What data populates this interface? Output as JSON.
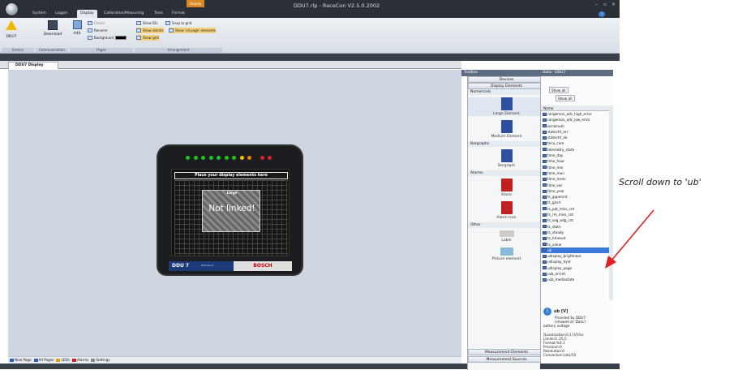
{
  "window": {
    "title": "DDU7.rlp - RaceCon V2.5.0.2002",
    "context_tab": "Display",
    "minimize": "–",
    "maximize": "▫",
    "close": "×",
    "help": "?"
  },
  "tabs": [
    "System",
    "Logger",
    "Display",
    "Calibration/Measuring",
    "Tools",
    "Format"
  ],
  "ribbon": {
    "ddu7_label": "DDU7",
    "download_label": "Download",
    "add_label": "Add",
    "create": "Create",
    "rename": "Rename",
    "background": "Background",
    "show_ids": "Show IDs",
    "snap_to_grid": "Snap to grid",
    "show_alarms": "Show alarms",
    "show_all_page_elements": "Show 'all page' elements",
    "show_grid": "Show grid",
    "groups": [
      "Device",
      "Communication",
      "Pages",
      "Arrangement"
    ]
  },
  "document": {
    "tab": "DDU7 Display",
    "screen_header": "Place your display elements here",
    "element_label": "Large",
    "element_text": "Not linked!",
    "device_name": "DDU 7",
    "brand": "BOSCH",
    "brand_sub": "Motorsport"
  },
  "leds": [
    "#1cc41c",
    "#1cc41c",
    "#1cc41c",
    "#1cc41c",
    "#1cc41c",
    "#1cc41c",
    "#1cc41c",
    "#f0c000",
    "#f08000",
    "#e02020",
    "#e02020"
  ],
  "page_tabs": [
    "New Page",
    "All Pages",
    "LEDs",
    "Alarms",
    "Settings"
  ],
  "toolbox": {
    "title": "Toolbox",
    "devices": "Devices",
    "display_elements": "Display Elements",
    "sections": {
      "numericals": "Numericals",
      "bargraphs": "Bargraphs",
      "alarms": "Alarms",
      "other": "Other"
    },
    "items": {
      "large": "Large Element",
      "medium": "Medium Element",
      "bargraph": "Bargraph",
      "alarm": "Alarm",
      "alarm_icon": "Alarm Icon",
      "label": "Label",
      "picture": "Picture element"
    },
    "measurement_elements": "Measurement Elements",
    "measurement_sources": "Measurement Sources"
  },
  "data": {
    "title": "Data - DDU7",
    "show_all": "Show all",
    "column": "Name",
    "items": [
      "rangemon_adc_high_error",
      "rangemon_adc_low_error",
      "serialnum",
      "statectrl_err",
      "statectrl_ok",
      "tecu_core",
      "telemetry_state",
      "time_day",
      "time_hour",
      "time_min",
      "time_mon",
      "time_msec",
      "time_sec",
      "time_year",
      "ts_gapercnt",
      "ts_glcnt",
      "ts_pat_miss_cnt",
      "ts_rm_miss_cnt",
      "ts_seg_edg_cnt",
      "ts_state",
      "ts_steady",
      "ts_timeout",
      "ts_value",
      "ub",
      "udisplay_brightness",
      "udisplay_hyst",
      "udisplay_page",
      "usb_errcnt",
      "usb_mediastate"
    ],
    "selected_index": 23,
    "info": {
      "name": "ub [V]",
      "provided": "Provided by DDU7",
      "showed": "(showed at 'Data')",
      "desc": "battery voltage",
      "quant": "Quantisation:0,1 [V]/inc",
      "limits": "Limits:0..25,5",
      "format": "Format:%4.1",
      "precision": "Precision:0",
      "resolution": "Resolution:0",
      "conversion": "Conversion:(ub)/10"
    }
  },
  "annotation": "Scroll down to 'ub'",
  "colors": {
    "accent": "#3c78d8",
    "arrow": "#e02020"
  }
}
